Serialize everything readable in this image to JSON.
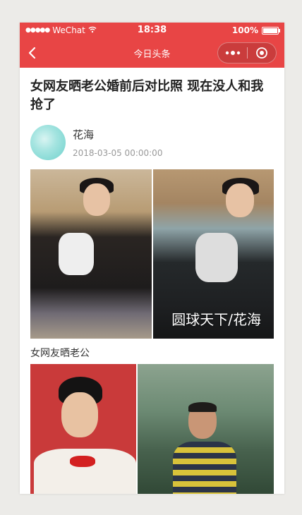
{
  "statusbar": {
    "carrier": "WeChat",
    "time": "18:38",
    "battery": "100%"
  },
  "navbar": {
    "title": "今日头条"
  },
  "article": {
    "title": "女网友晒老公婚前后对比照 现在没人和我抢了",
    "author": "花海",
    "date": "2018-03-05 00:00:00",
    "watermark": "圆球天下/花海",
    "caption": "女网友晒老公"
  },
  "colors": {
    "brand": "#e84545"
  },
  "icons": [
    "back-arrow-icon",
    "more-dots-icon",
    "capsule-close-icon",
    "wifi-icon",
    "battery-icon",
    "signal-dots-icon"
  ]
}
